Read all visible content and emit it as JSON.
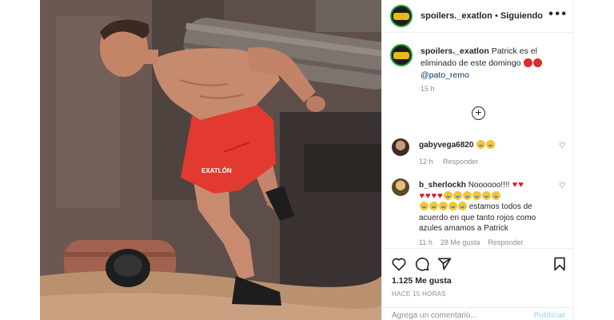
{
  "post": {
    "username": "spoilers._exatlon",
    "separator": "•",
    "follow_status": "Siguiendo",
    "more_icon": "more-horizontal-icon"
  },
  "caption": {
    "username": "spoilers._exatlon",
    "text": "Patrick es el eliminado de este domingo",
    "mention": "@pato_remo",
    "time": "15 h"
  },
  "comments": [
    {
      "username": "gabyvega6820",
      "text": "",
      "time": "12 h",
      "reply": "Responder",
      "likes": ""
    },
    {
      "username": "b_sherlockh",
      "text": "Noooooo!!!!",
      "text2": "estamos todos de acuerdo en que tanto rojos como azules amamos a Patrick",
      "time": "11 h",
      "likes": "28 Me gusta",
      "reply": "Responder"
    }
  ],
  "actions": {
    "likes": "1.125 Me gusta",
    "ago": "HACE 15 HORAS",
    "comment_placeholder": "Agrega un comentario...",
    "publish": "Publicar"
  },
  "photo": {
    "shorts_logo_text": "EXATLÓN"
  },
  "colors": {
    "accent_link": "#00376b",
    "publish_disabled": "#b2dffc",
    "emoji_heart": "#e0182d",
    "shorts": "#e8332b"
  }
}
